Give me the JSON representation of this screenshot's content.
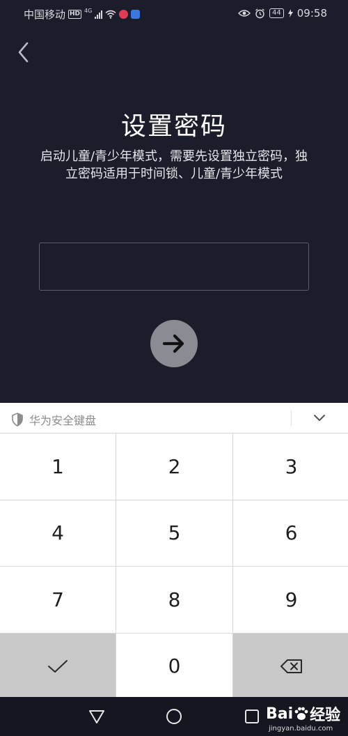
{
  "status_bar": {
    "carrier": "中国移动",
    "hd": "HD",
    "network": "4G",
    "battery": "44",
    "time": "09:58"
  },
  "page": {
    "title": "设置密码",
    "description": "启动儿童/青少年模式，需要先设置独立密码，独立密码适用于时间锁、儿童/青少年模式",
    "password_value": "",
    "password_placeholder": ""
  },
  "keyboard": {
    "brand": "华为安全键盘",
    "keys": [
      "1",
      "2",
      "3",
      "4",
      "5",
      "6",
      "7",
      "8",
      "9",
      "0"
    ]
  },
  "watermark": {
    "brand_left": "Bai",
    "brand_right": "经验",
    "url": "jingyan.baidu.com"
  },
  "colors": {
    "background": "#1c1d2a",
    "next_button": "#8b8c93",
    "keyboard_dark_key": "#c8c8c8"
  },
  "icons": [
    "back-arrow-icon",
    "arrow-right-icon",
    "shield-icon",
    "chevron-down-icon",
    "check-icon",
    "backspace-icon",
    "nav-back-icon",
    "nav-home-icon",
    "nav-recents-icon"
  ]
}
